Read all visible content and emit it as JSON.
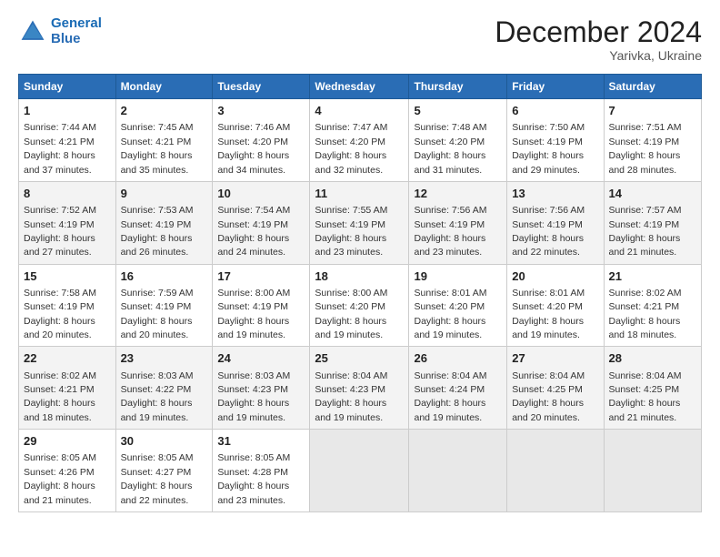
{
  "header": {
    "logo_line1": "General",
    "logo_line2": "Blue",
    "month": "December 2024",
    "location": "Yarivka, Ukraine"
  },
  "days_of_week": [
    "Sunday",
    "Monday",
    "Tuesday",
    "Wednesday",
    "Thursday",
    "Friday",
    "Saturday"
  ],
  "weeks": [
    [
      {
        "day": 1,
        "rise": "7:44 AM",
        "set": "4:21 PM",
        "daylight": "8 hours and 37 minutes."
      },
      {
        "day": 2,
        "rise": "7:45 AM",
        "set": "4:21 PM",
        "daylight": "8 hours and 35 minutes."
      },
      {
        "day": 3,
        "rise": "7:46 AM",
        "set": "4:20 PM",
        "daylight": "8 hours and 34 minutes."
      },
      {
        "day": 4,
        "rise": "7:47 AM",
        "set": "4:20 PM",
        "daylight": "8 hours and 32 minutes."
      },
      {
        "day": 5,
        "rise": "7:48 AM",
        "set": "4:20 PM",
        "daylight": "8 hours and 31 minutes."
      },
      {
        "day": 6,
        "rise": "7:50 AM",
        "set": "4:19 PM",
        "daylight": "8 hours and 29 minutes."
      },
      {
        "day": 7,
        "rise": "7:51 AM",
        "set": "4:19 PM",
        "daylight": "8 hours and 28 minutes."
      }
    ],
    [
      {
        "day": 8,
        "rise": "7:52 AM",
        "set": "4:19 PM",
        "daylight": "8 hours and 27 minutes."
      },
      {
        "day": 9,
        "rise": "7:53 AM",
        "set": "4:19 PM",
        "daylight": "8 hours and 26 minutes."
      },
      {
        "day": 10,
        "rise": "7:54 AM",
        "set": "4:19 PM",
        "daylight": "8 hours and 24 minutes."
      },
      {
        "day": 11,
        "rise": "7:55 AM",
        "set": "4:19 PM",
        "daylight": "8 hours and 23 minutes."
      },
      {
        "day": 12,
        "rise": "7:56 AM",
        "set": "4:19 PM",
        "daylight": "8 hours and 23 minutes."
      },
      {
        "day": 13,
        "rise": "7:56 AM",
        "set": "4:19 PM",
        "daylight": "8 hours and 22 minutes."
      },
      {
        "day": 14,
        "rise": "7:57 AM",
        "set": "4:19 PM",
        "daylight": "8 hours and 21 minutes."
      }
    ],
    [
      {
        "day": 15,
        "rise": "7:58 AM",
        "set": "4:19 PM",
        "daylight": "8 hours and 20 minutes."
      },
      {
        "day": 16,
        "rise": "7:59 AM",
        "set": "4:19 PM",
        "daylight": "8 hours and 20 minutes."
      },
      {
        "day": 17,
        "rise": "8:00 AM",
        "set": "4:19 PM",
        "daylight": "8 hours and 19 minutes."
      },
      {
        "day": 18,
        "rise": "8:00 AM",
        "set": "4:20 PM",
        "daylight": "8 hours and 19 minutes."
      },
      {
        "day": 19,
        "rise": "8:01 AM",
        "set": "4:20 PM",
        "daylight": "8 hours and 19 minutes."
      },
      {
        "day": 20,
        "rise": "8:01 AM",
        "set": "4:20 PM",
        "daylight": "8 hours and 19 minutes."
      },
      {
        "day": 21,
        "rise": "8:02 AM",
        "set": "4:21 PM",
        "daylight": "8 hours and 18 minutes."
      }
    ],
    [
      {
        "day": 22,
        "rise": "8:02 AM",
        "set": "4:21 PM",
        "daylight": "8 hours and 18 minutes."
      },
      {
        "day": 23,
        "rise": "8:03 AM",
        "set": "4:22 PM",
        "daylight": "8 hours and 19 minutes."
      },
      {
        "day": 24,
        "rise": "8:03 AM",
        "set": "4:23 PM",
        "daylight": "8 hours and 19 minutes."
      },
      {
        "day": 25,
        "rise": "8:04 AM",
        "set": "4:23 PM",
        "daylight": "8 hours and 19 minutes."
      },
      {
        "day": 26,
        "rise": "8:04 AM",
        "set": "4:24 PM",
        "daylight": "8 hours and 19 minutes."
      },
      {
        "day": 27,
        "rise": "8:04 AM",
        "set": "4:25 PM",
        "daylight": "8 hours and 20 minutes."
      },
      {
        "day": 28,
        "rise": "8:04 AM",
        "set": "4:25 PM",
        "daylight": "8 hours and 21 minutes."
      }
    ],
    [
      {
        "day": 29,
        "rise": "8:05 AM",
        "set": "4:26 PM",
        "daylight": "8 hours and 21 minutes."
      },
      {
        "day": 30,
        "rise": "8:05 AM",
        "set": "4:27 PM",
        "daylight": "8 hours and 22 minutes."
      },
      {
        "day": 31,
        "rise": "8:05 AM",
        "set": "4:28 PM",
        "daylight": "8 hours and 23 minutes."
      },
      null,
      null,
      null,
      null
    ]
  ]
}
